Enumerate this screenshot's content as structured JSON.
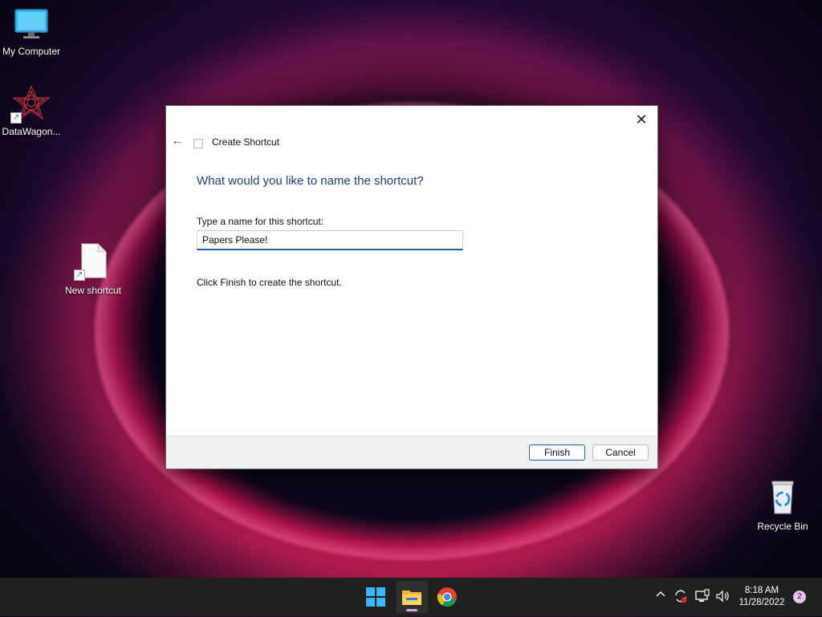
{
  "desktop": {
    "icons": [
      {
        "label": "My Computer",
        "icon": "monitor-icon"
      },
      {
        "label": "DataWagon...",
        "icon": "datawagon-icon"
      },
      {
        "label": "New shortcut",
        "icon": "file-icon"
      },
      {
        "label": "Recycle Bin",
        "icon": "recycle-bin-icon"
      }
    ]
  },
  "dialog": {
    "title": "Create Shortcut",
    "heading": "What would you like to name the shortcut?",
    "field_label": "Type a name for this shortcut:",
    "name_value": "Papers Please!",
    "hint": "Click Finish to create the shortcut.",
    "finish_label": "Finish",
    "cancel_label": "Cancel",
    "close_glyph": "✕",
    "back_glyph": "←"
  },
  "taskbar": {
    "apps": [
      {
        "name": "Start",
        "icon": "windows-start-icon"
      },
      {
        "name": "File Explorer",
        "icon": "folder-icon",
        "active": true
      },
      {
        "name": "Chrome",
        "icon": "chrome-icon"
      }
    ],
    "tray": {
      "chevron_glyph": "^"
    },
    "clock": {
      "time": "8:18 AM",
      "date": "11/28/2022"
    },
    "notifications": "2"
  },
  "colors": {
    "accent": "#1f5fb8",
    "heading": "#1e3f7a",
    "taskbar": "#202020"
  }
}
